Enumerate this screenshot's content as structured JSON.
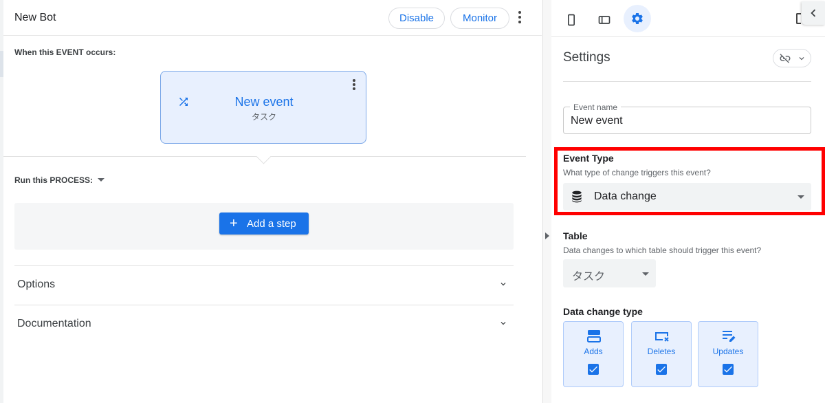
{
  "header": {
    "title": "New Bot",
    "disable_label": "Disable",
    "monitor_label": "Monitor"
  },
  "event_section": {
    "label": "When this EVENT occurs:",
    "card_title": "New event",
    "card_subtitle": "タスク"
  },
  "process_section": {
    "label": "Run this PROCESS:",
    "add_step_label": "Add a step"
  },
  "accordions": [
    {
      "label": "Options"
    },
    {
      "label": "Documentation"
    }
  ],
  "settings": {
    "title": "Settings",
    "event_name_label": "Event name",
    "event_name_value": "New event",
    "event_type": {
      "title": "Event Type",
      "subtitle": "What type of change triggers this event?",
      "selected": "Data change"
    },
    "table": {
      "title": "Table",
      "subtitle": "Data changes to which table should trigger this event?",
      "selected": "タスク"
    },
    "data_change_type": {
      "title": "Data change type",
      "options": [
        {
          "label": "Adds",
          "checked": true
        },
        {
          "label": "Deletes",
          "checked": true
        },
        {
          "label": "Updates",
          "checked": true
        }
      ]
    }
  },
  "colors": {
    "accent": "#1a73e8",
    "highlight": "#ff0000",
    "card_bg": "#e8f0fe"
  },
  "icons": [
    "shuffle-icon",
    "phone-icon",
    "tablet-icon",
    "gear-icon",
    "link-off-icon",
    "chevron-left-icon",
    "database-icon",
    "adds-icon",
    "deletes-icon",
    "updates-icon",
    "checkbox-checked-icon"
  ]
}
